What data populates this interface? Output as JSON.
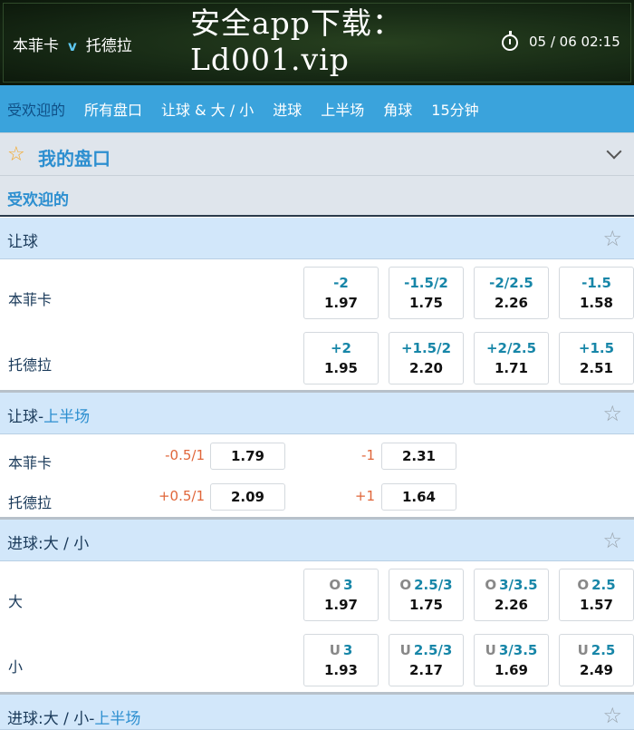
{
  "header": {
    "home": "本菲卡",
    "vs": "v",
    "away": "托德拉",
    "promo": "安全app下载：\nLd001.vip",
    "datetime": "05 / 06  02:15"
  },
  "tabs": [
    "受欢迎的",
    "所有盘口",
    "让球 & 大 / 小",
    "进球",
    "上半场",
    "角球",
    "15分钟"
  ],
  "my_markets": {
    "title": "我的盘口"
  },
  "popular_label": "受欢迎的",
  "handicap": {
    "title": "让球",
    "rows": [
      {
        "team": "本菲卡",
        "cells": [
          {
            "h": "-2",
            "o": "1.97"
          },
          {
            "h": "-1.5/2",
            "o": "1.75"
          },
          {
            "h": "-2/2.5",
            "o": "2.26"
          },
          {
            "h": "-1.5",
            "o": "1.58"
          }
        ]
      },
      {
        "team": "托德拉",
        "cells": [
          {
            "h": "+2",
            "o": "1.95"
          },
          {
            "h": "+1.5/2",
            "o": "2.20"
          },
          {
            "h": "+2/2.5",
            "o": "1.71"
          },
          {
            "h": "+1.5",
            "o": "2.51"
          }
        ]
      }
    ]
  },
  "handicap_half": {
    "title": "让球-",
    "title_hl": "上半场",
    "rows": [
      {
        "team": "本菲卡",
        "l1": "-0.5/1",
        "o1": "1.79",
        "l2": "-1",
        "o2": "2.31"
      },
      {
        "team": "托德拉",
        "l1": "+0.5/1",
        "o1": "2.09",
        "l2": "+1",
        "o2": "1.64"
      }
    ]
  },
  "totals": {
    "title": "进球:大 / 小",
    "rows": [
      {
        "team": "大",
        "prefix": "O",
        "cells": [
          {
            "h": "3",
            "o": "1.97"
          },
          {
            "h": "2.5/3",
            "o": "1.75"
          },
          {
            "h": "3/3.5",
            "o": "2.26"
          },
          {
            "h": "2.5",
            "o": "1.57"
          }
        ]
      },
      {
        "team": "小",
        "prefix": "U",
        "cells": [
          {
            "h": "3",
            "o": "1.93"
          },
          {
            "h": "2.5/3",
            "o": "2.17"
          },
          {
            "h": "3/3.5",
            "o": "1.69"
          },
          {
            "h": "2.5",
            "o": "2.49"
          }
        ]
      }
    ]
  },
  "totals_half": {
    "title": "进球:大 / 小-",
    "title_hl": "上半场"
  }
}
